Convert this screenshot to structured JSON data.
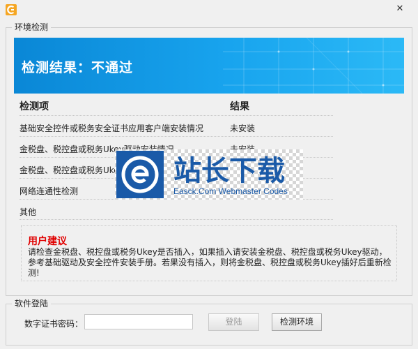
{
  "window": {
    "close_glyph": "✕"
  },
  "env_group": {
    "title": "环境检测",
    "banner_title": "检测结果：不通过",
    "table": {
      "headers": [
        "检测项",
        "结果"
      ],
      "rows": [
        {
          "item": "基础安全控件或税务安全证书应用客户端安装情况",
          "result": "未安装"
        },
        {
          "item": "金税盘、税控盘或税务Ukey驱动安装情况",
          "result": "未安装"
        },
        {
          "item": "金税盘、税控盘或税务Ukey",
          "result": ""
        },
        {
          "item": "网络连通性检测",
          "result": ""
        },
        {
          "item": "其他",
          "result": ""
        }
      ]
    },
    "advice": {
      "title": "用户建议",
      "body": "请检查金税盘、税控盘或税务Ukey是否插入，如果插入请安装金税盘、税控盘或税务Ukey驱动，参考基础驱动及安全控件安装手册。若果没有插入，则将金税盘、税控盘或税务Ukey插好后重新检测!"
    }
  },
  "login_group": {
    "title": "软件登陆",
    "cert_label": "数字证书密码：",
    "cert_value": "",
    "login_button": "登陆",
    "check_button": "检测环境"
  },
  "watermark": {
    "title": "站长下载",
    "subtitle": "Easck.Com Webmaster Codes"
  },
  "colors": {
    "banner": "#18a4ee",
    "advice_title": "#e00000",
    "watermark_blue": "#1a5aa8"
  },
  "icons": {
    "app": "app-logo-icon",
    "close": "close-icon",
    "watermark": "e-logo-icon"
  }
}
